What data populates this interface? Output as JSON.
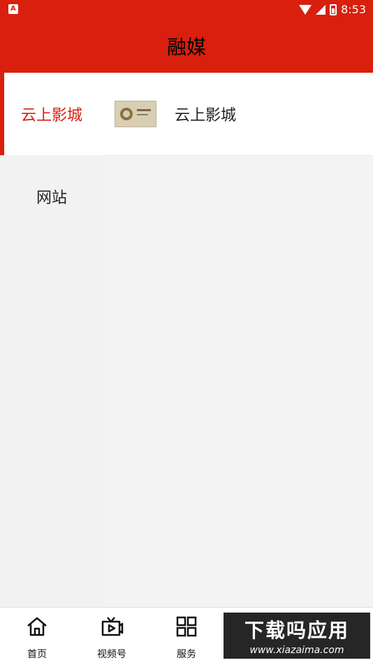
{
  "status": {
    "time": "8:53",
    "icon_label": "A"
  },
  "appbar": {
    "title": "融媒"
  },
  "left_nav": {
    "items": [
      {
        "label": "云上影城",
        "active": true
      },
      {
        "label": "网站",
        "active": false
      }
    ]
  },
  "content": {
    "items": [
      {
        "label": "云上影城",
        "thumbnail": "cinema-thumbnail"
      }
    ]
  },
  "bottom_nav": {
    "tabs": [
      {
        "label": "首页",
        "icon": "home-icon"
      },
      {
        "label": "视频号",
        "icon": "video-tv-icon"
      },
      {
        "label": "服务",
        "icon": "grid-icon"
      }
    ]
  },
  "watermark": {
    "title": "下载吗应用",
    "url": "www.xiazaima.com"
  },
  "colors": {
    "brand_red": "#d91f0d",
    "background": "#f2f2f2"
  }
}
